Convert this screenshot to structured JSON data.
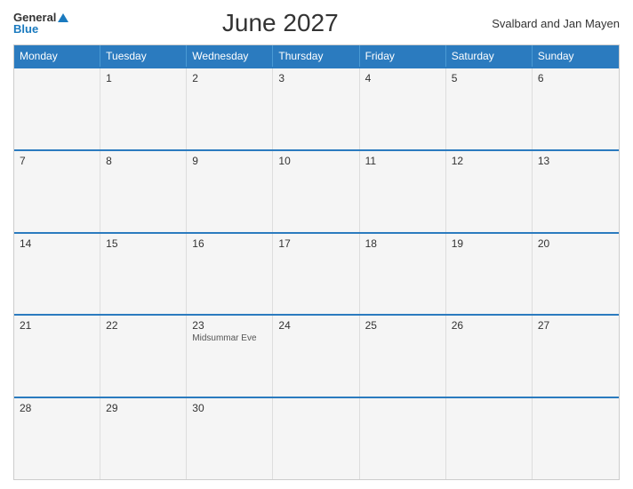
{
  "header": {
    "logo": {
      "general": "General",
      "blue": "Blue",
      "triangle": "▲"
    },
    "title": "June 2027",
    "region": "Svalbard and Jan Mayen"
  },
  "calendar": {
    "days_of_week": [
      "Monday",
      "Tuesday",
      "Wednesday",
      "Thursday",
      "Friday",
      "Saturday",
      "Sunday"
    ],
    "weeks": [
      [
        {
          "day": "",
          "holiday": ""
        },
        {
          "day": "1",
          "holiday": ""
        },
        {
          "day": "2",
          "holiday": ""
        },
        {
          "day": "3",
          "holiday": ""
        },
        {
          "day": "4",
          "holiday": ""
        },
        {
          "day": "5",
          "holiday": ""
        },
        {
          "day": "6",
          "holiday": ""
        }
      ],
      [
        {
          "day": "7",
          "holiday": ""
        },
        {
          "day": "8",
          "holiday": ""
        },
        {
          "day": "9",
          "holiday": ""
        },
        {
          "day": "10",
          "holiday": ""
        },
        {
          "day": "11",
          "holiday": ""
        },
        {
          "day": "12",
          "holiday": ""
        },
        {
          "day": "13",
          "holiday": ""
        }
      ],
      [
        {
          "day": "14",
          "holiday": ""
        },
        {
          "day": "15",
          "holiday": ""
        },
        {
          "day": "16",
          "holiday": ""
        },
        {
          "day": "17",
          "holiday": ""
        },
        {
          "day": "18",
          "holiday": ""
        },
        {
          "day": "19",
          "holiday": ""
        },
        {
          "day": "20",
          "holiday": ""
        }
      ],
      [
        {
          "day": "21",
          "holiday": ""
        },
        {
          "day": "22",
          "holiday": ""
        },
        {
          "day": "23",
          "holiday": "Midsummar Eve"
        },
        {
          "day": "24",
          "holiday": ""
        },
        {
          "day": "25",
          "holiday": ""
        },
        {
          "day": "26",
          "holiday": ""
        },
        {
          "day": "27",
          "holiday": ""
        }
      ],
      [
        {
          "day": "28",
          "holiday": ""
        },
        {
          "day": "29",
          "holiday": ""
        },
        {
          "day": "30",
          "holiday": ""
        },
        {
          "day": "",
          "holiday": ""
        },
        {
          "day": "",
          "holiday": ""
        },
        {
          "day": "",
          "holiday": ""
        },
        {
          "day": "",
          "holiday": ""
        }
      ]
    ]
  }
}
